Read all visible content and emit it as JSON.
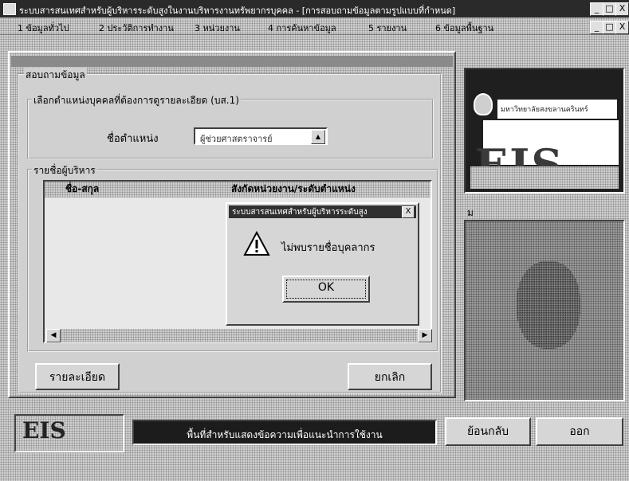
{
  "window": {
    "title": "ระบบสารสนเทศสำหรับผู้บริหารระดับสูงในงานบริหารงานทรัพยากรบุคคล - [การสอบถามข้อมูลตามรูปแบบที่กำหนด]",
    "controls": [
      "_",
      "□",
      "X"
    ]
  },
  "menu": {
    "items": [
      "1 ข้อมูลทั่วไป",
      "2 ประวัติการทำงาน",
      "3 หน่วยงาน",
      "4 การค้นหาข้อมูล",
      "5 รายงาน",
      "6 ข้อมูลพื้นฐาน"
    ],
    "controls": [
      "_",
      "□",
      "X"
    ]
  },
  "form": {
    "caption": "สอบถามข้อมูล",
    "criteria_group": "เลือกตำแหน่งบุคคลที่ต้องการดูรายละเอียด (บส.1)",
    "position_label": "ชื่อตำแหน่ง",
    "position_value": "ผู้ช่วยศาสตราจารย์",
    "list_group": "รายชื่อผู้บริหาร",
    "col_name": "ชื่อ-สกุล",
    "col_position": "สังกัดหน่วยงาน/ระดับตำแหน่ง",
    "details_button": "รายละเอียด",
    "cancel_button": "ยกเลิก"
  },
  "dialog": {
    "title": "ระบบสารสนเทศสำหรับผู้บริหารระดับสูง",
    "close": "X",
    "message": "ไม่พบรายชื่อบุคลากร",
    "ok": "OK"
  },
  "logo": {
    "university": "มหาวิทยาลัยสงขลานครินทร์",
    "text": "EIS"
  },
  "photo_caption": "ม",
  "bottom": {
    "logo_text": "EIS",
    "status_text": "พื้นที่สำหรับแสดงข้อความเพื่อแนะนำการใช้งาน",
    "back_button": "ย้อนกลับ",
    "exit_button": "ออก"
  }
}
